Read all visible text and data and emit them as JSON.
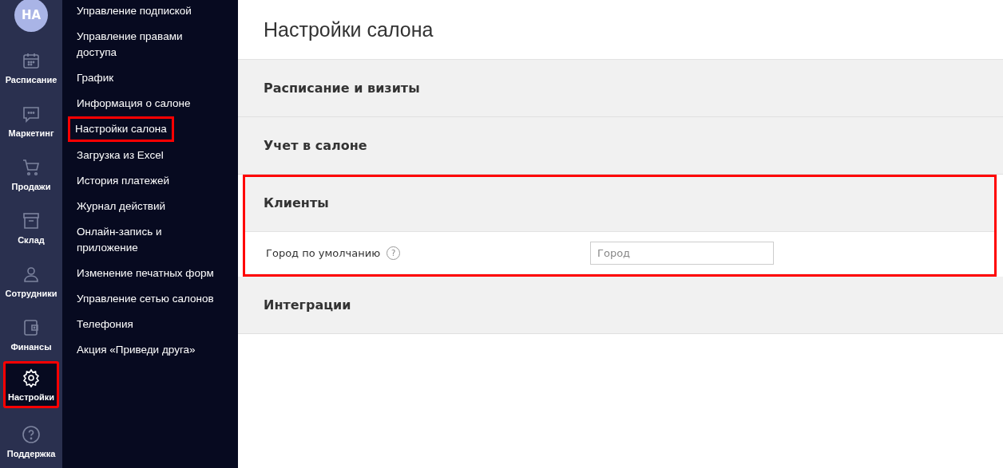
{
  "avatar": {
    "initials": "НА"
  },
  "rail": [
    {
      "kind": "calendar",
      "label": "Расписание",
      "selected": false,
      "highlighted": false
    },
    {
      "kind": "chat",
      "label": "Маркетинг",
      "selected": false,
      "highlighted": false
    },
    {
      "kind": "cart",
      "label": "Продажи",
      "selected": false,
      "highlighted": false
    },
    {
      "kind": "archive",
      "label": "Склад",
      "selected": false,
      "highlighted": false
    },
    {
      "kind": "person",
      "label": "Сотрудники",
      "selected": false,
      "highlighted": false
    },
    {
      "kind": "wallet",
      "label": "Финансы",
      "selected": false,
      "highlighted": false
    },
    {
      "kind": "gear",
      "label": "Настройки",
      "selected": true,
      "highlighted": true
    },
    {
      "kind": "help",
      "label": "Поддержка",
      "selected": false,
      "highlighted": false
    }
  ],
  "submenu": [
    {
      "label": "Управление подпиской",
      "highlighted": false
    },
    {
      "label": "Управление правами доступа",
      "highlighted": false
    },
    {
      "label": "График",
      "highlighted": false
    },
    {
      "label": "Информация о салоне",
      "highlighted": false
    },
    {
      "label": "Настройки салона",
      "highlighted": true
    },
    {
      "label": "Загрузка из Excel",
      "highlighted": false
    },
    {
      "label": "История платежей",
      "highlighted": false
    },
    {
      "label": "Журнал действий",
      "highlighted": false
    },
    {
      "label": "Онлайн-запись и приложение",
      "highlighted": false
    },
    {
      "label": "Изменение печатных форм",
      "highlighted": false
    },
    {
      "label": "Управление сетью салонов",
      "highlighted": false
    },
    {
      "label": "Телефония",
      "highlighted": false
    },
    {
      "label": "Акция «Приведи друга»",
      "highlighted": false
    }
  ],
  "page": {
    "title": "Настройки салона"
  },
  "sections": [
    {
      "title": "Расписание и визиты",
      "highlighted": false
    },
    {
      "title": "Учет в салоне",
      "highlighted": false
    },
    {
      "title": "Клиенты",
      "highlighted": true,
      "fields": [
        {
          "label": "Город по умолчанию",
          "help": "?",
          "placeholder": "Город"
        }
      ]
    },
    {
      "title": "Интеграции",
      "highlighted": false
    }
  ]
}
